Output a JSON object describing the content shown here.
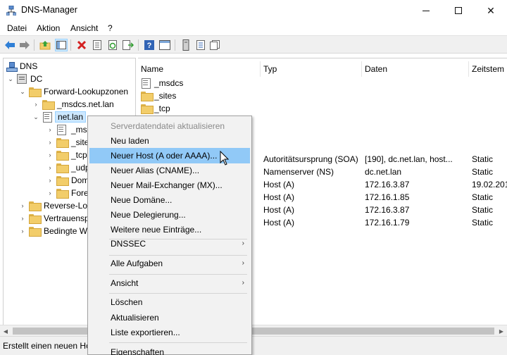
{
  "window": {
    "title": "DNS-Manager",
    "minimize_glyph": "",
    "close_glyph": "✕"
  },
  "menu": [
    "Datei",
    "Aktion",
    "Ansicht",
    "?"
  ],
  "toolbar": {
    "icons": [
      "back-arrow-icon",
      "forward-arrow-icon",
      "up-folder-icon",
      "show-hide-tree-icon",
      "delete-icon",
      "properties-icon",
      "refresh-icon",
      "export-list-icon",
      "help-icon",
      "console-view-icon",
      "server-icon",
      "list-icon",
      "records-icon"
    ]
  },
  "tree": {
    "root": "DNS",
    "server": "DC",
    "forward": "Forward-Lookupzonen",
    "msdcs_zone": "_msdcs.net.lan",
    "net_zone": "net.lan",
    "children": [
      "_ms",
      "_site",
      "_tcp",
      "_udp",
      "Dom",
      "Fore"
    ],
    "reverse": "Reverse-Loo",
    "trust": "Vertrauensp",
    "conditional": "Bedingte W"
  },
  "list": {
    "columns": [
      "Name",
      "Typ",
      "Daten",
      "Zeitstem"
    ],
    "rows": [
      {
        "name": "_msdcs",
        "typ": "",
        "daten": "",
        "zeit": "",
        "icon": "zone"
      },
      {
        "name": "_sites",
        "typ": "",
        "daten": "",
        "zeit": "",
        "icon": "folder"
      },
      {
        "name": "_tcp",
        "typ": "",
        "daten": "",
        "zeit": "",
        "icon": "folder"
      },
      {
        "name": "",
        "typ": "Autoritätsursprung (SOA)",
        "daten": "[190], dc.net.lan, host...",
        "zeit": "Static",
        "icon": ""
      },
      {
        "name": "",
        "typ": "Namenserver (NS)",
        "daten": "dc.net.lan",
        "zeit": "Static",
        "icon": ""
      },
      {
        "name": "",
        "typ": "Host (A)",
        "daten": "172.16.3.87",
        "zeit": "19.02.201",
        "icon": ""
      },
      {
        "name": "",
        "typ": "Host (A)",
        "daten": "172.16.1.85",
        "zeit": "Static",
        "icon": ""
      },
      {
        "name": "",
        "typ": "Host (A)",
        "daten": "172.16.3.87",
        "zeit": "Static",
        "icon": ""
      },
      {
        "name": "",
        "typ": "Host (A)",
        "daten": "172.16.1.79",
        "zeit": "Static",
        "icon": ""
      }
    ]
  },
  "context_menu": {
    "items": [
      {
        "label": "Serverdatendatei aktualisieren",
        "disabled": true
      },
      {
        "label": "Neu laden"
      },
      {
        "label": "Neuer Host (A oder AAAA)...",
        "highlighted": true
      },
      {
        "label": "Neuer Alias (CNAME)..."
      },
      {
        "label": "Neuer Mail-Exchanger (MX)..."
      },
      {
        "label": "Neue Domäne..."
      },
      {
        "label": "Neue Delegierung..."
      },
      {
        "label": "Weitere neue Einträge..."
      },
      {
        "label": "DNSSEC",
        "submenu": true
      },
      {
        "label": "Alle Aufgaben",
        "submenu": true
      },
      {
        "label": "Ansicht",
        "submenu": true
      },
      {
        "label": "Löschen"
      },
      {
        "label": "Aktualisieren"
      },
      {
        "label": "Liste exportieren..."
      },
      {
        "label": "Eigenschaften"
      }
    ],
    "submenu_arrow": "›"
  },
  "status": "Erstellt einen neuen Ho"
}
